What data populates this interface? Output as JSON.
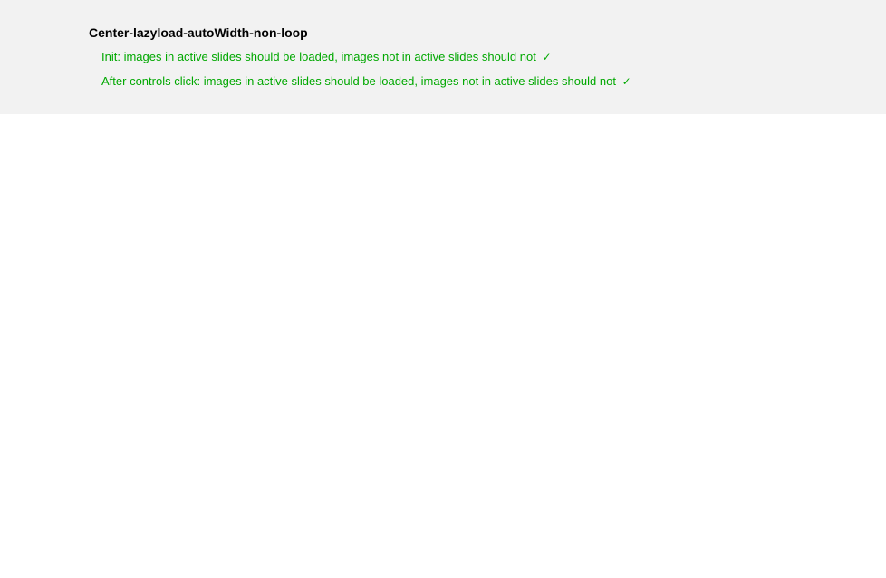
{
  "title": "Center-lazyload-autoWidth-non-loop",
  "tests": [
    {
      "text": "Init: images in active slides should be loaded, images not in active slides should not",
      "check": "✓"
    },
    {
      "text": "After controls click: images in active slides should be loaded, images not in active slides should not",
      "check": "✓"
    }
  ]
}
